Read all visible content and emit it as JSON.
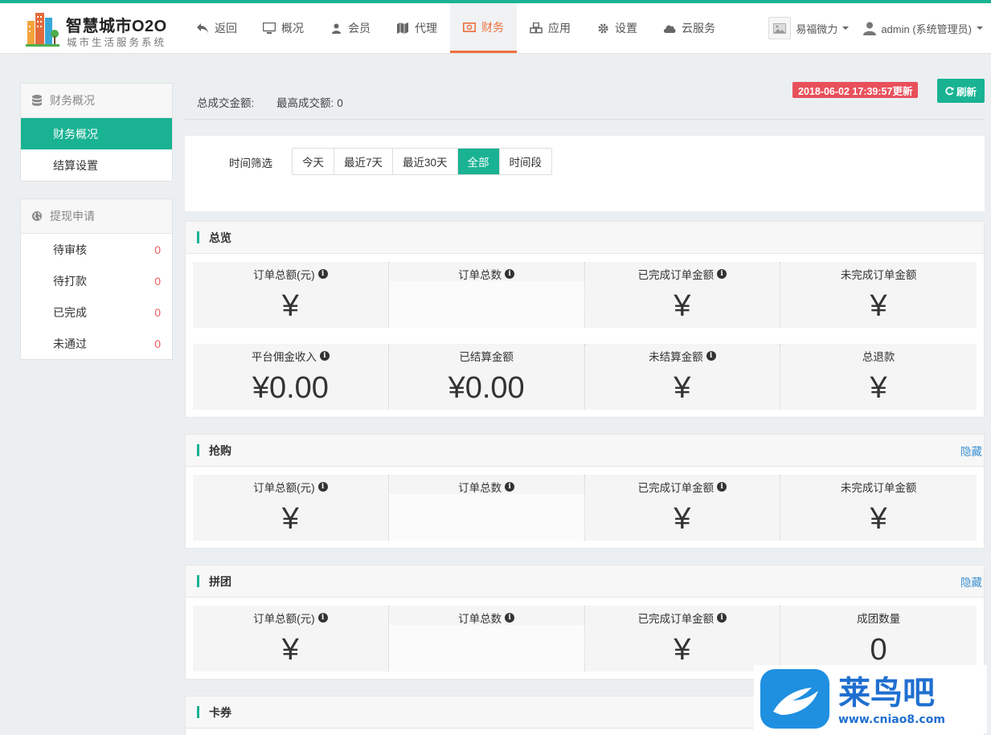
{
  "brand": {
    "title": "智慧城市O2O",
    "subtitle": "城市生活服务系统"
  },
  "nav": [
    {
      "label": "返回",
      "icon": "reply-icon"
    },
    {
      "label": "概况",
      "icon": "monitor-icon"
    },
    {
      "label": "会员",
      "icon": "user-icon"
    },
    {
      "label": "代理",
      "icon": "map-icon"
    },
    {
      "label": "财务",
      "icon": "money-icon",
      "active": true
    },
    {
      "label": "应用",
      "icon": "cubes-icon"
    },
    {
      "label": "设置",
      "icon": "gear-icon"
    },
    {
      "label": "云服务",
      "icon": "cloud-icon"
    }
  ],
  "account": {
    "site_name": "易福微力",
    "user": "admin (系统管理员)"
  },
  "sidebar": {
    "finance_head": "财务概况",
    "finance_items": [
      {
        "label": "财务概况",
        "active": true
      },
      {
        "label": "结算设置"
      }
    ],
    "withdraw_head": "提现申请",
    "withdraw_items": [
      {
        "label": "待审核",
        "count": "0"
      },
      {
        "label": "待打款",
        "count": "0"
      },
      {
        "label": "已完成",
        "count": "0"
      },
      {
        "label": "未通过",
        "count": "0"
      }
    ]
  },
  "summary": {
    "total_label": "总成交金额:",
    "max_label": "最高成交额:",
    "max_value": "0",
    "updated": "2018-06-02 17:39:57更新",
    "refresh": "刷新"
  },
  "filter": {
    "label": "时间筛选",
    "options": [
      "今天",
      "最近7天",
      "最近30天",
      "全部",
      "时间段"
    ],
    "selected": "全部"
  },
  "sections": {
    "overview": {
      "title": "总览",
      "rows": [
        [
          {
            "label": "订单总额(元)",
            "info": true,
            "value": "¥"
          },
          {
            "label": "订单总数",
            "info": true,
            "value": ""
          },
          {
            "label": "已完成订单金额",
            "info": true,
            "value": "¥"
          },
          {
            "label": "未完成订单金额",
            "info": false,
            "value": "¥"
          }
        ],
        [
          {
            "label": "平台佣金收入",
            "info": true,
            "value": "¥0.00"
          },
          {
            "label": "已结算金额",
            "info": false,
            "value": "¥0.00"
          },
          {
            "label": "未结算金额",
            "info": true,
            "value": "¥"
          },
          {
            "label": "总退款",
            "info": false,
            "value": "¥"
          }
        ]
      ]
    },
    "flash": {
      "title": "抢购",
      "hide": "隐藏",
      "row": [
        {
          "label": "订单总额(元)",
          "info": true,
          "value": "¥"
        },
        {
          "label": "订单总数",
          "info": true,
          "value": ""
        },
        {
          "label": "已完成订单金额",
          "info": true,
          "value": "¥"
        },
        {
          "label": "未完成订单金额",
          "info": false,
          "value": "¥"
        }
      ]
    },
    "group": {
      "title": "拼团",
      "hide": "隐藏",
      "row": [
        {
          "label": "订单总额(元)",
          "info": true,
          "value": "¥"
        },
        {
          "label": "订单总数",
          "info": true,
          "value": ""
        },
        {
          "label": "已完成订单金额",
          "info": true,
          "value": "¥"
        },
        {
          "label": "成团数量",
          "info": false,
          "value": "0"
        }
      ]
    },
    "coupon": {
      "title": "卡券"
    }
  },
  "colors": {
    "accent": "#19b393",
    "active_nav": "#ef6f3c",
    "badge": "#e8505b",
    "link": "#3a8fd1"
  }
}
